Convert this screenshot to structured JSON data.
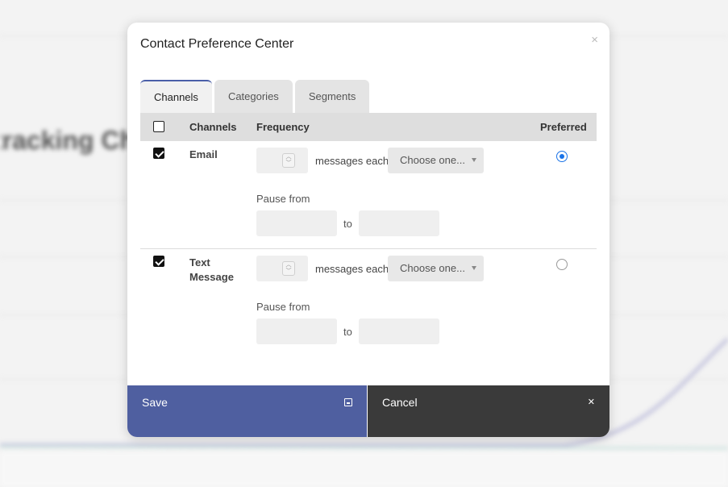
{
  "background": {
    "heading_fragment": "tracking Ch"
  },
  "modal": {
    "title": "Contact Preference Center",
    "close_symbol": "×"
  },
  "tabs": [
    {
      "label": "Channels",
      "active": true
    },
    {
      "label": "Categories",
      "active": false
    },
    {
      "label": "Segments",
      "active": false
    }
  ],
  "table": {
    "headers": {
      "channels": "Channels",
      "frequency": "Frequency",
      "preferred": "Preferred"
    },
    "select_all_checked": false,
    "rows": [
      {
        "channel": "Email",
        "checked": true,
        "frequency_value": "",
        "messages_each": "messages each",
        "period_select": "Choose one...",
        "pause_label": "Pause from",
        "pause_from": "",
        "to_label": "to",
        "pause_to": "",
        "preferred": true
      },
      {
        "channel": "Text Message",
        "checked": true,
        "frequency_value": "",
        "messages_each": "messages each",
        "period_select": "Choose one...",
        "pause_label": "Pause from",
        "pause_from": "",
        "to_label": "to",
        "pause_to": "",
        "preferred": false
      }
    ]
  },
  "footer": {
    "save_label": "Save",
    "save_icon": "save-icon",
    "cancel_label": "Cancel",
    "cancel_symbol": "✕"
  },
  "colors": {
    "save_bg": "#4f5fa0",
    "cancel_bg": "#3a3a3a",
    "tab_accent": "#4a5fa8",
    "radio_accent": "#1a73e8"
  }
}
